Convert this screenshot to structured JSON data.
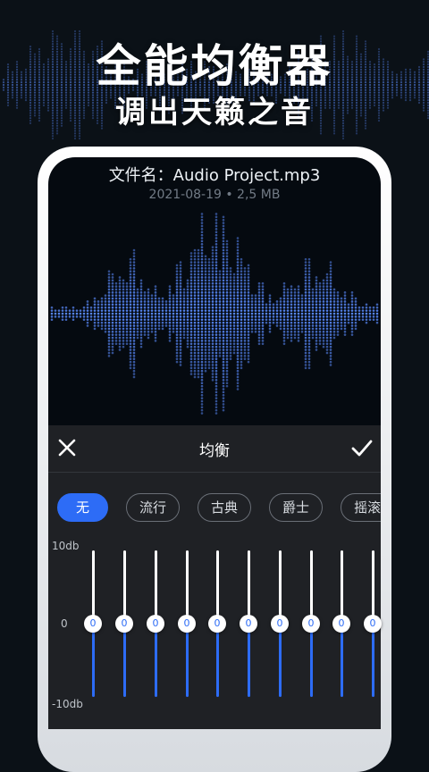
{
  "promo": {
    "headline": "全能均衡器",
    "subheadline": "调出天籁之音"
  },
  "file": {
    "name": "文件名：Audio Project.mp3",
    "meta": "2021-08-19 • 2,5 MB"
  },
  "equalizer": {
    "title": "均衡",
    "close_icon": "close-icon",
    "confirm_icon": "check-icon",
    "presets": [
      {
        "label": "无",
        "active": true
      },
      {
        "label": "流行",
        "active": false
      },
      {
        "label": "古典",
        "active": false
      },
      {
        "label": "爵士",
        "active": false
      },
      {
        "label": "摇滚",
        "active": false
      }
    ],
    "scale": {
      "top": "10db",
      "middle": "0",
      "bottom": "-10db"
    },
    "bands": [
      0,
      0,
      0,
      0,
      0,
      0,
      0,
      0,
      0,
      0
    ]
  },
  "colors": {
    "accent": "#2d6cf6",
    "wave": "#5b8cff",
    "background": "#0b1117"
  }
}
